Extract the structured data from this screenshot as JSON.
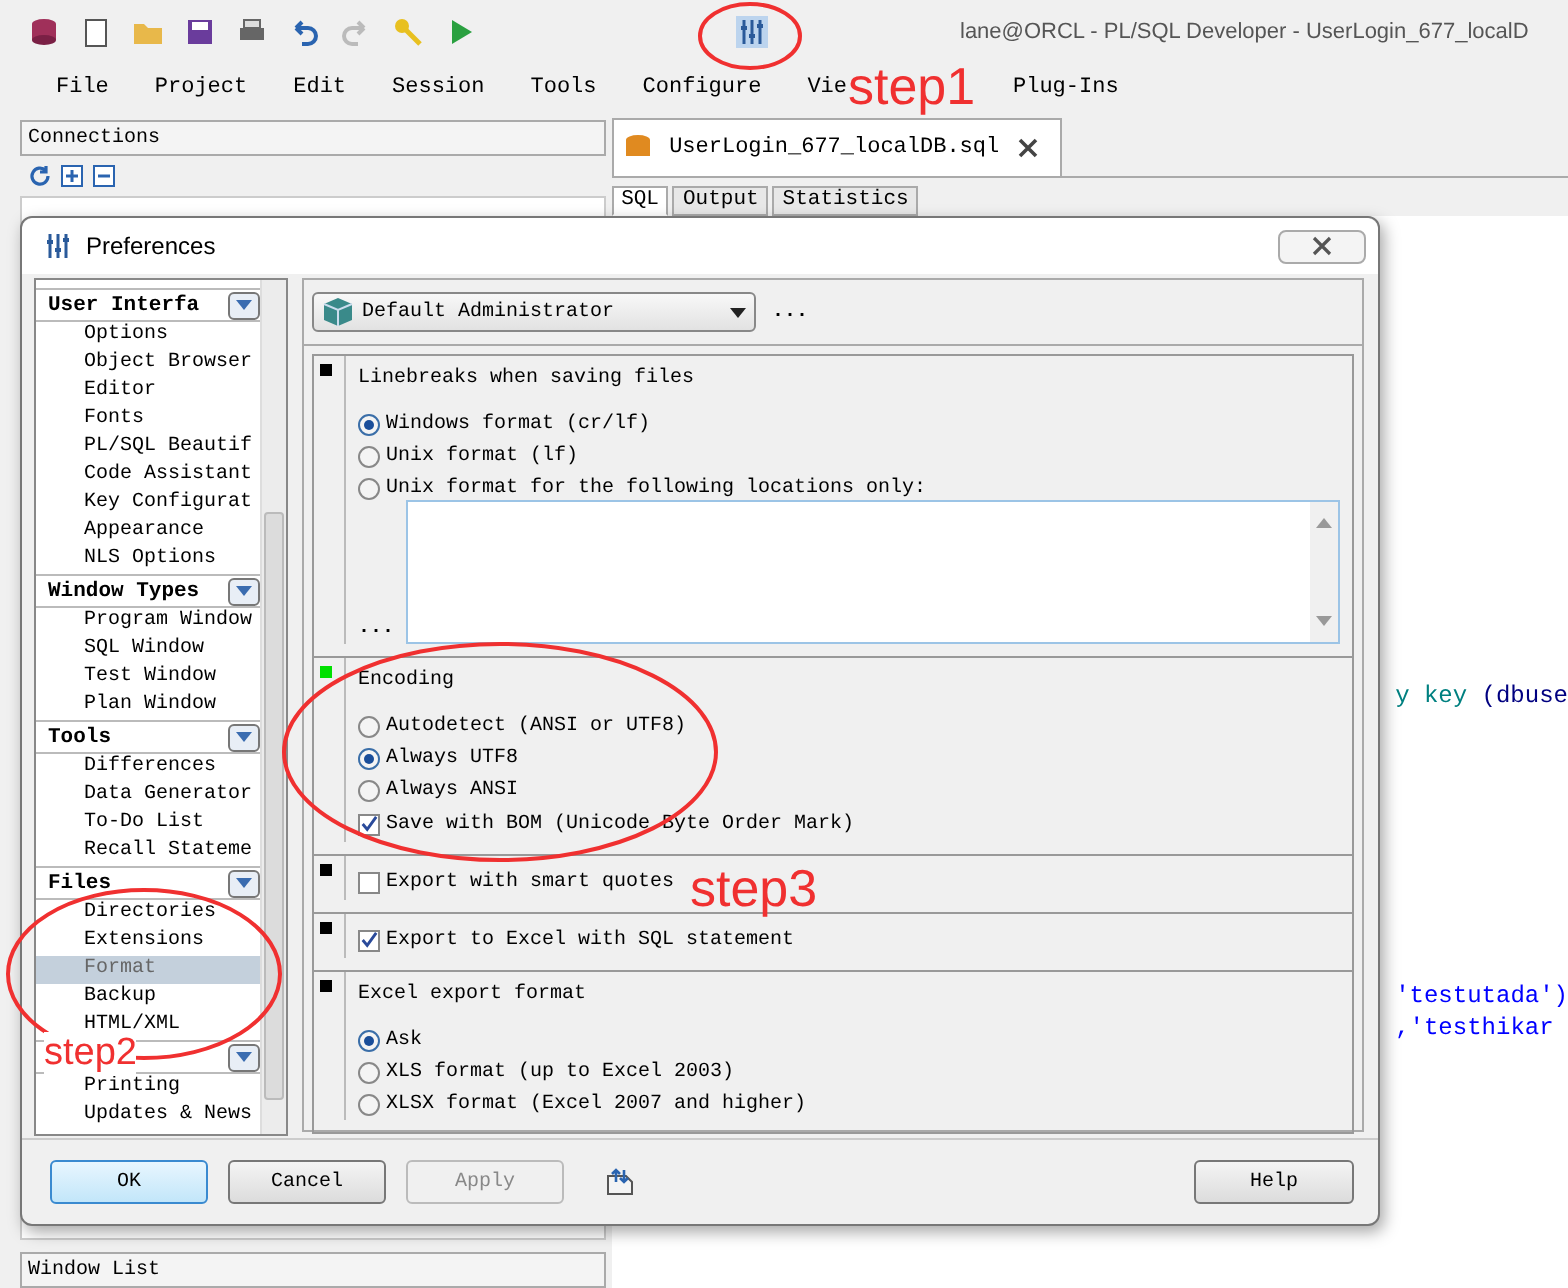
{
  "app": {
    "title": "lane@ORCL - PL/SQL Developer - UserLogin_677_localD",
    "menu": [
      "File",
      "Project",
      "Edit",
      "Session",
      "Tools",
      "Configure",
      "Vie",
      "Plug-Ins"
    ]
  },
  "connections": {
    "title": "Connections"
  },
  "editor": {
    "tab": "UserLogin_677_localDB.sql",
    "subtabs": [
      {
        "label": "SQL",
        "selected": true
      },
      {
        "label": "Output",
        "selected": false
      },
      {
        "label": "Statistics",
        "selected": false
      }
    ],
    "code_lines": [
      [
        {
          "kind": "keyword",
          "text": "y key"
        },
        {
          "kind": "plain",
          "text": "(dbuse"
        }
      ],
      [
        {
          "kind": "string",
          "text": "'testutada')"
        }
      ],
      [
        {
          "kind": "string",
          "text": ",'testhikar"
        }
      ]
    ]
  },
  "window_list": {
    "title": "Window List"
  },
  "dialog": {
    "title": "Preferences",
    "tree": [
      {
        "label": "User Interfa",
        "items": [
          {
            "label": "Options",
            "selected": false
          },
          {
            "label": "Object Browser",
            "selected": false
          },
          {
            "label": "Editor",
            "selected": false
          },
          {
            "label": "Fonts",
            "selected": false
          },
          {
            "label": "PL/SQL Beautif",
            "selected": false
          },
          {
            "label": "Code Assistant",
            "selected": false
          },
          {
            "label": "Key Configurat",
            "selected": false
          },
          {
            "label": "Appearance",
            "selected": false
          },
          {
            "label": "NLS Options",
            "selected": false
          }
        ]
      },
      {
        "label": "Window Types",
        "items": [
          {
            "label": "Program Window",
            "selected": false
          },
          {
            "label": "SQL Window",
            "selected": false
          },
          {
            "label": "Test Window",
            "selected": false
          },
          {
            "label": "Plan Window",
            "selected": false
          }
        ]
      },
      {
        "label": "Tools",
        "items": [
          {
            "label": "Differences",
            "selected": false
          },
          {
            "label": "Data Generator",
            "selected": false
          },
          {
            "label": "To-Do List",
            "selected": false
          },
          {
            "label": "Recall Stateme",
            "selected": false
          }
        ]
      },
      {
        "label": "Files",
        "items": [
          {
            "label": "Directories",
            "selected": false
          },
          {
            "label": "Extensions",
            "selected": false
          },
          {
            "label": "Format",
            "selected": true
          },
          {
            "label": "Backup",
            "selected": false
          },
          {
            "label": "HTML/XML",
            "selected": false
          }
        ]
      },
      {
        "items": [
          {
            "label": "Printing",
            "selected": false
          },
          {
            "label": "Updates & News",
            "selected": false
          }
        ]
      }
    ],
    "profile": "Default Administrator",
    "more": "...",
    "sections": [
      {
        "color": "#000000",
        "title": "Linebreaks when saving files",
        "options": [
          {
            "label": "Windows format (cr/lf)",
            "selected": true
          },
          {
            "label": "Unix format (lf)",
            "selected": false
          },
          {
            "label": "Unix format for the following locations only:",
            "selected": false
          }
        ],
        "list_button": "..."
      },
      {
        "color": "#00e000",
        "title": "Encoding",
        "options": [
          {
            "label": "Autodetect (ANSI or UTF8)",
            "selected": false
          },
          {
            "label": "Always UTF8",
            "selected": true
          },
          {
            "label": "Always ANSI",
            "selected": false
          }
        ],
        "checkboxes": [
          {
            "label": "Save with BOM (Unicode Byte Order Mark)",
            "checked": true
          }
        ]
      },
      {
        "color": "#000000",
        "checkboxes": [
          {
            "label": "Export with smart quotes",
            "checked": false
          }
        ]
      },
      {
        "color": "#000000",
        "checkboxes": [
          {
            "label": "Export to Excel with SQL statement",
            "checked": true
          }
        ]
      },
      {
        "color": "#000000",
        "title": "Excel export format",
        "options": [
          {
            "label": "Ask",
            "selected": true
          },
          {
            "label": "XLS format (up to Excel 2003)",
            "selected": false
          },
          {
            "label": "XLSX format (Excel 2007 and higher)",
            "selected": false
          }
        ]
      }
    ],
    "buttons": [
      {
        "label": "OK",
        "kind": "default",
        "disabled": false
      },
      {
        "label": "Cancel",
        "kind": "normal",
        "disabled": false
      },
      {
        "label": "Apply",
        "kind": "normal",
        "disabled": true
      },
      {
        "kind": "icon",
        "disabled": false
      },
      {
        "label": "Help",
        "kind": "right",
        "disabled": false
      }
    ]
  },
  "annotations": [
    {
      "text": "step1"
    },
    {
      "text": "step2"
    },
    {
      "text": "step3"
    }
  ]
}
